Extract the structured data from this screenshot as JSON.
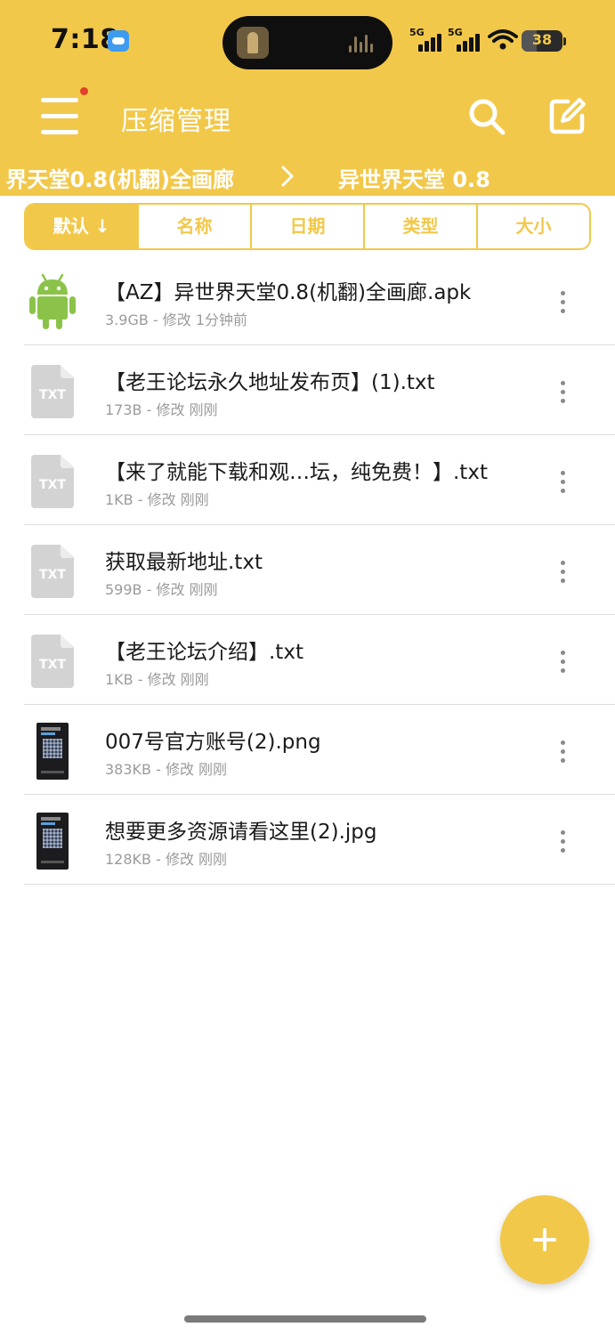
{
  "status_bar": {
    "time": "7:18",
    "weather_icon": "weather-app-icon",
    "signal_1": "5G",
    "signal_2": "5G",
    "battery": "38"
  },
  "header": {
    "title": "压缩管理",
    "color": "#F2C84A",
    "menu_icon": "hamburger-menu-icon",
    "search_icon": "search-icon",
    "edit_icon": "edit-icon"
  },
  "breadcrumb": {
    "previous": "界天堂0.8(机翻)全画廊",
    "separator_icon": "chevron-right-icon",
    "current": "异世界天堂 0.8"
  },
  "sort_tabs": [
    {
      "label": "默认 ↓",
      "active": true
    },
    {
      "label": "名称",
      "active": false
    },
    {
      "label": "日期",
      "active": false
    },
    {
      "label": "类型",
      "active": false
    },
    {
      "label": "大小",
      "active": false
    }
  ],
  "files": [
    {
      "name": "【AZ】异世界天堂0.8(机翻)全画廊.apk",
      "meta": "3.9GB - 修改 1分钟前",
      "icon": "android-icon"
    },
    {
      "name": "【老王论坛永久地址发布页】(1).txt",
      "meta": "173B - 修改 刚刚",
      "icon": "txt-file-icon",
      "icon_label": "TXT"
    },
    {
      "name": "【来了就能下载和观…坛，纯免费！】.txt",
      "meta": "1KB - 修改 刚刚",
      "icon": "txt-file-icon",
      "icon_label": "TXT"
    },
    {
      "name": "获取最新地址.txt",
      "meta": "599B - 修改 刚刚",
      "icon": "txt-file-icon",
      "icon_label": "TXT"
    },
    {
      "name": "【老王论坛介绍】.txt",
      "meta": "1KB - 修改 刚刚",
      "icon": "txt-file-icon",
      "icon_label": "TXT"
    },
    {
      "name": "007号官方账号(2).png",
      "meta": "383KB - 修改 刚刚",
      "icon": "image-thumbnail"
    },
    {
      "name": "想要更多资源请看这里(2).jpg",
      "meta": "128KB - 修改 刚刚",
      "icon": "image-thumbnail"
    }
  ],
  "fab": {
    "icon": "plus-icon"
  }
}
